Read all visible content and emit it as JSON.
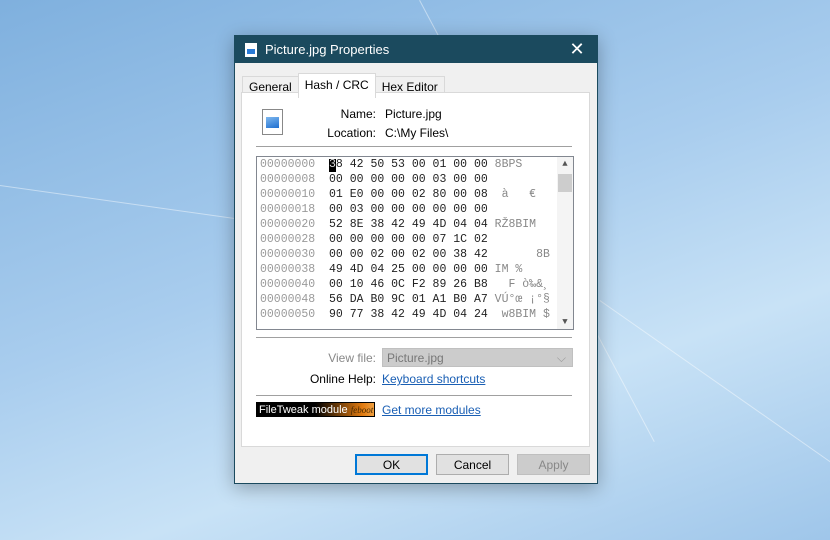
{
  "window": {
    "title": "Picture.jpg Properties",
    "close": "✕"
  },
  "tabs": [
    {
      "label": "General"
    },
    {
      "label": "Hash / CRC"
    },
    {
      "label": "Hex Editor"
    }
  ],
  "file": {
    "name_label": "Name:",
    "name": "Picture.jpg",
    "location_label": "Location:",
    "location": "C:\\My Files\\"
  },
  "hex_rows": [
    {
      "o": "00000000",
      "b": "38 42 50 53 00 01 00 00",
      "a": "8BPS"
    },
    {
      "o": "00000008",
      "b": "00 00 00 00 00 03 00 00",
      "a": ""
    },
    {
      "o": "00000010",
      "b": "01 E0 00 00 02 80 00 08",
      "a": " à   €"
    },
    {
      "o": "00000018",
      "b": "00 03 00 00 00 00 00 00",
      "a": ""
    },
    {
      "o": "00000020",
      "b": "52 8E 38 42 49 4D 04 04",
      "a": "RŽ8BIM"
    },
    {
      "o": "00000028",
      "b": "00 00 00 00 00 07 1C 02",
      "a": ""
    },
    {
      "o": "00000030",
      "b": "00 00 02 00 02 00 38 42",
      "a": "      8B"
    },
    {
      "o": "00000038",
      "b": "49 4D 04 25 00 00 00 00",
      "a": "IM %"
    },
    {
      "o": "00000040",
      "b": "00 10 46 0C F2 89 26 B8",
      "a": "  F ò‰&¸"
    },
    {
      "o": "00000048",
      "b": "56 DA B0 9C 01 A1 B0 A7",
      "a": "VÚ°œ ¡°§"
    },
    {
      "o": "00000050",
      "b": "90 77 38 42 49 4D 04 24",
      "a": " w8BIM $"
    }
  ],
  "view_file": {
    "label": "View file:",
    "value": "Picture.jpg"
  },
  "help": {
    "label": "Online Help:",
    "link": "Keyboard shortcuts"
  },
  "module": {
    "badge": "FileTweak module",
    "brand": "feboot",
    "link": "Get more modules"
  },
  "buttons": {
    "ok": "OK",
    "cancel": "Cancel",
    "apply": "Apply"
  }
}
